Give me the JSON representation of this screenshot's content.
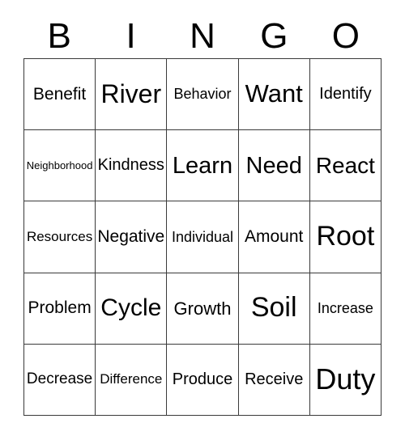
{
  "card": {
    "title": "BINGO",
    "header_letters": [
      "B",
      "I",
      "N",
      "G",
      "O"
    ],
    "grid_columns": 5,
    "grid_rows": 5,
    "border_color": "#3a3a3a",
    "text_color": "#000000",
    "background_color": "#ffffff",
    "cells": [
      {
        "text": "Benefit",
        "font_size": "21px",
        "column": "B",
        "row": 1
      },
      {
        "text": "River",
        "font_size": "32px",
        "column": "I",
        "row": 1
      },
      {
        "text": "Behavior",
        "font_size": "18px",
        "column": "N",
        "row": 1
      },
      {
        "text": "Want",
        "font_size": "31px",
        "column": "G",
        "row": 1
      },
      {
        "text": "Identify",
        "font_size": "20px",
        "column": "O",
        "row": 1
      },
      {
        "text": "Neighborhood",
        "font_size": "13px",
        "column": "B",
        "row": 2
      },
      {
        "text": "Kindness",
        "font_size": "20px",
        "column": "I",
        "row": 2
      },
      {
        "text": "Learn",
        "font_size": "29px",
        "column": "N",
        "row": 2
      },
      {
        "text": "Need",
        "font_size": "29px",
        "column": "G",
        "row": 2
      },
      {
        "text": "React",
        "font_size": "28px",
        "column": "O",
        "row": 2
      },
      {
        "text": "Resources",
        "font_size": "17px",
        "column": "B",
        "row": 3
      },
      {
        "text": "Negative",
        "font_size": "21px",
        "column": "I",
        "row": 3
      },
      {
        "text": "Individual",
        "font_size": "18px",
        "column": "N",
        "row": 3
      },
      {
        "text": "Amount",
        "font_size": "21px",
        "column": "G",
        "row": 3
      },
      {
        "text": "Root",
        "font_size": "34px",
        "column": "O",
        "row": 3
      },
      {
        "text": "Problem",
        "font_size": "21px",
        "column": "B",
        "row": 4
      },
      {
        "text": "Cycle",
        "font_size": "30px",
        "column": "I",
        "row": 4
      },
      {
        "text": "Growth",
        "font_size": "22px",
        "column": "N",
        "row": 4
      },
      {
        "text": "Soil",
        "font_size": "34px",
        "column": "G",
        "row": 4
      },
      {
        "text": "Increase",
        "font_size": "18px",
        "column": "O",
        "row": 4
      },
      {
        "text": "Decrease",
        "font_size": "19px",
        "column": "B",
        "row": 5
      },
      {
        "text": "Difference",
        "font_size": "17px",
        "column": "I",
        "row": 5
      },
      {
        "text": "Produce",
        "font_size": "20px",
        "column": "N",
        "row": 5
      },
      {
        "text": "Receive",
        "font_size": "20px",
        "column": "G",
        "row": 5
      },
      {
        "text": "Duty",
        "font_size": "36px",
        "column": "O",
        "row": 5
      }
    ]
  }
}
